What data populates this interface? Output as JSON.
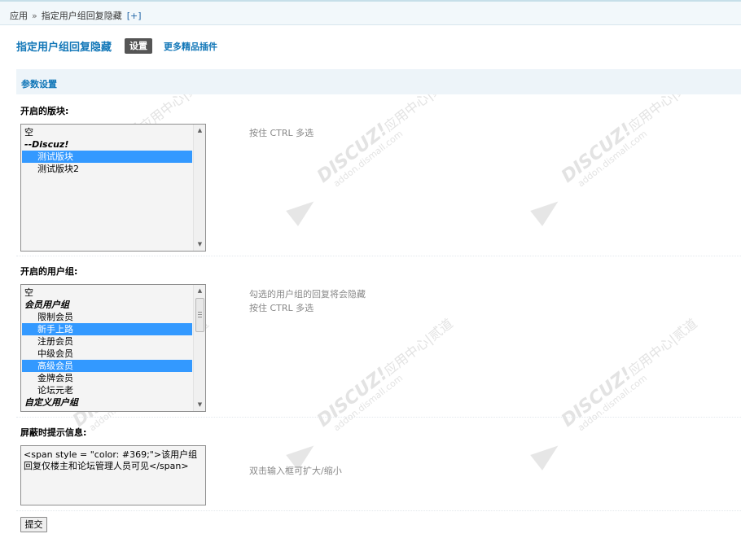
{
  "breadcrumb": {
    "root": "应用",
    "separator": "»",
    "current": "指定用户组回复隐藏",
    "add": "[+]"
  },
  "header": {
    "title": "指定用户组回复隐藏",
    "tab_settings": "设置",
    "more_plugins": "更多精品插件"
  },
  "section": {
    "title": "参数设置"
  },
  "forums": {
    "label": "开启的版块:",
    "hint": "按住 CTRL 多选",
    "options": [
      {
        "text": "空",
        "selected": false,
        "group": false,
        "indent": false
      },
      {
        "text": "--Discuz!",
        "selected": false,
        "group": true,
        "indent": false
      },
      {
        "text": "测试版块",
        "selected": true,
        "group": false,
        "indent": true
      },
      {
        "text": "测试版块2",
        "selected": false,
        "group": false,
        "indent": true
      }
    ]
  },
  "usergroups": {
    "label": "开启的用户组:",
    "hint_line1": "勾选的用户组的回复将会隐藏",
    "hint_line2": "按住 CTRL 多选",
    "options": [
      {
        "text": "空",
        "selected": false,
        "group": false,
        "indent": false
      },
      {
        "text": "会员用户组",
        "selected": false,
        "group": true,
        "indent": false
      },
      {
        "text": "限制会员",
        "selected": false,
        "group": false,
        "indent": true
      },
      {
        "text": "新手上路",
        "selected": true,
        "group": false,
        "indent": true
      },
      {
        "text": "注册会员",
        "selected": false,
        "group": false,
        "indent": true
      },
      {
        "text": "中级会员",
        "selected": false,
        "group": false,
        "indent": true
      },
      {
        "text": "高级会员",
        "selected": true,
        "group": false,
        "indent": true
      },
      {
        "text": "金牌会员",
        "selected": false,
        "group": false,
        "indent": true
      },
      {
        "text": "论坛元老",
        "selected": false,
        "group": false,
        "indent": true
      },
      {
        "text": "自定义用户组",
        "selected": false,
        "group": true,
        "indent": false
      }
    ]
  },
  "message": {
    "label": "屏蔽时提示信息:",
    "value": "<span style = \"color: #369;\">该用户组回复仅楼主和论坛管理人员可见</span>",
    "hint": "双击输入框可扩大/缩小"
  },
  "submit_label": "提交",
  "watermark": {
    "brand": "DISCUZ!",
    "cn": "应用中心",
    "divider": "|",
    "cn2": "贰道",
    "url": "addon.dismall.com"
  },
  "colors": {
    "accent": "#1277b8",
    "selection": "#3399ff"
  },
  "icons": {
    "scroll_up": "scroll-up-arrow-icon",
    "scroll_down": "scroll-down-arrow-icon"
  }
}
